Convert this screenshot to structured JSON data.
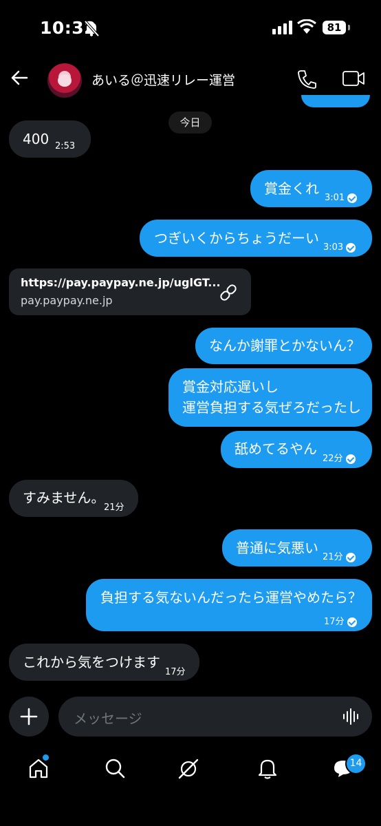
{
  "status_bar": {
    "time": "10:32",
    "battery": "81"
  },
  "header": {
    "contact_name": "あいる＠迅速リレー運営"
  },
  "date_separator": "今日",
  "messages": [
    {
      "dir": "in",
      "text": "400",
      "time": "2:53"
    },
    {
      "dir": "out",
      "text": "賞金くれ",
      "time": "3:01"
    },
    {
      "dir": "out",
      "text": "つぎいくからちょうだーい",
      "time": "3:03"
    },
    {
      "dir": "in",
      "link": {
        "url": "https://pay.paypay.ne.jp/uglGT...",
        "domain": "pay.paypay.ne.jp"
      }
    },
    {
      "dir": "out",
      "text": "なんか謝罪とかないん？"
    },
    {
      "dir": "out",
      "lines": [
        "賞金対応遅いし",
        "運営負担する気ぜろだったし"
      ]
    },
    {
      "dir": "out",
      "text": "舐めてるやん",
      "time": "22分"
    },
    {
      "dir": "in",
      "text": "すみません。",
      "time": "21分"
    },
    {
      "dir": "out",
      "text": "普通に気悪い",
      "time": "21分"
    },
    {
      "dir": "out",
      "text": "負担する気ないんだったら運営やめたら？",
      "time": "17分"
    },
    {
      "dir": "in",
      "text": "これから気をつけます",
      "time": "17分"
    }
  ],
  "composer": {
    "placeholder": "メッセージ"
  },
  "nav": {
    "items": [
      "home-icon",
      "search-icon",
      "grok-icon",
      "notifications-icon",
      "messages-icon"
    ],
    "messages_badge": "14"
  },
  "colors": {
    "accent": "#1d9bf0",
    "incoming_bubble": "#202327",
    "background": "#000000"
  }
}
